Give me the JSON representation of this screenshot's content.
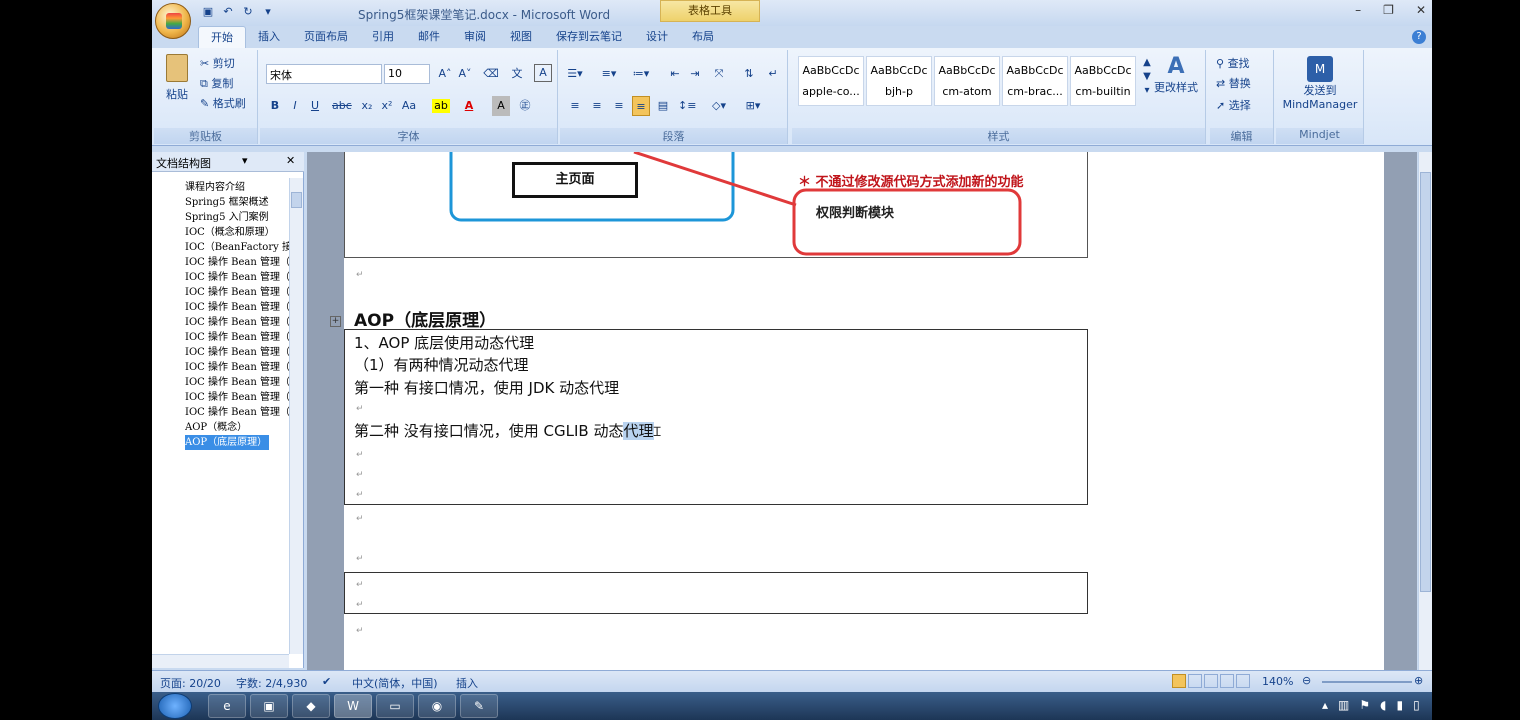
{
  "window": {
    "title": "Spring5框架课堂笔记.docx - Microsoft Word",
    "contextual_tab": "表格工具"
  },
  "tabs": [
    "开始",
    "插入",
    "页面布局",
    "引用",
    "邮件",
    "审阅",
    "视图",
    "保存到云笔记",
    "设计",
    "布局"
  ],
  "ribbon": {
    "clipboard": {
      "paste": "粘贴",
      "cut": "剪切",
      "copy": "复制",
      "format_painter": "格式刷",
      "label": "剪贴板"
    },
    "font": {
      "name": "宋体",
      "size": "10",
      "label": "字体"
    },
    "paragraph": {
      "label": "段落"
    },
    "styles": {
      "items": [
        {
          "preview": "AaBbCcDc",
          "name": "apple-co..."
        },
        {
          "preview": "AaBbCcDc",
          "name": "bjh-p"
        },
        {
          "preview": "AaBbCcDc",
          "name": "cm-atom"
        },
        {
          "preview": "AaBbCcDc",
          "name": "cm-brac..."
        },
        {
          "preview": "AaBbCcDc",
          "name": "cm-builtin"
        }
      ],
      "change_styles": "更改样式",
      "label": "样式"
    },
    "editing": {
      "find": "查找",
      "replace": "替换",
      "select": "选择",
      "label": "编辑"
    },
    "mindjet": {
      "send": "发送到",
      "app": "MindManager",
      "label": "Mindjet"
    }
  },
  "nav": {
    "title": "文档结构图",
    "items": [
      "课程内容介绍",
      "Spring5 框架概述",
      "Spring5 入门案例",
      "IOC（概念和原理）",
      "IOC（BeanFactory 接",
      "IOC 操作 Bean 管理（",
      "IOC 操作 Bean 管理（",
      "IOC 操作 Bean 管理（",
      "IOC 操作 Bean 管理（",
      "IOC 操作 Bean 管理（",
      "IOC 操作 Bean 管理（",
      "IOC 操作 Bean 管理（",
      "IOC 操作 Bean 管理（",
      "IOC 操作 Bean 管理（",
      "IOC 操作 Bean 管理（",
      "IOC 操作 Bean 管理（",
      "AOP（概念）",
      "AOP（底层原理）"
    ]
  },
  "doc": {
    "diagram_main_page": "主页面",
    "diagram_note": "＊ 不通过修改源代码方式添加新的功能",
    "diagram_module": "权限判断模块",
    "heading": "AOP（底层原理）",
    "lines": [
      "1、AOP 底层使用动态代理",
      "（1）有两种情况动态代理",
      "第一种 有接口情况，使用 JDK 动态代理",
      "第二种 没有接口情况，使用 CGLIB 动态",
      "代理"
    ]
  },
  "status": {
    "page": "页面: 20/20",
    "words": "字数: 2/4,930",
    "language": "中文(简体，中国)",
    "mode": "插入",
    "zoom": "140%"
  },
  "colors": {
    "accent_red": "#e0393a",
    "accent_blue": "#1d96d8",
    "note_text": "#c0141a"
  }
}
